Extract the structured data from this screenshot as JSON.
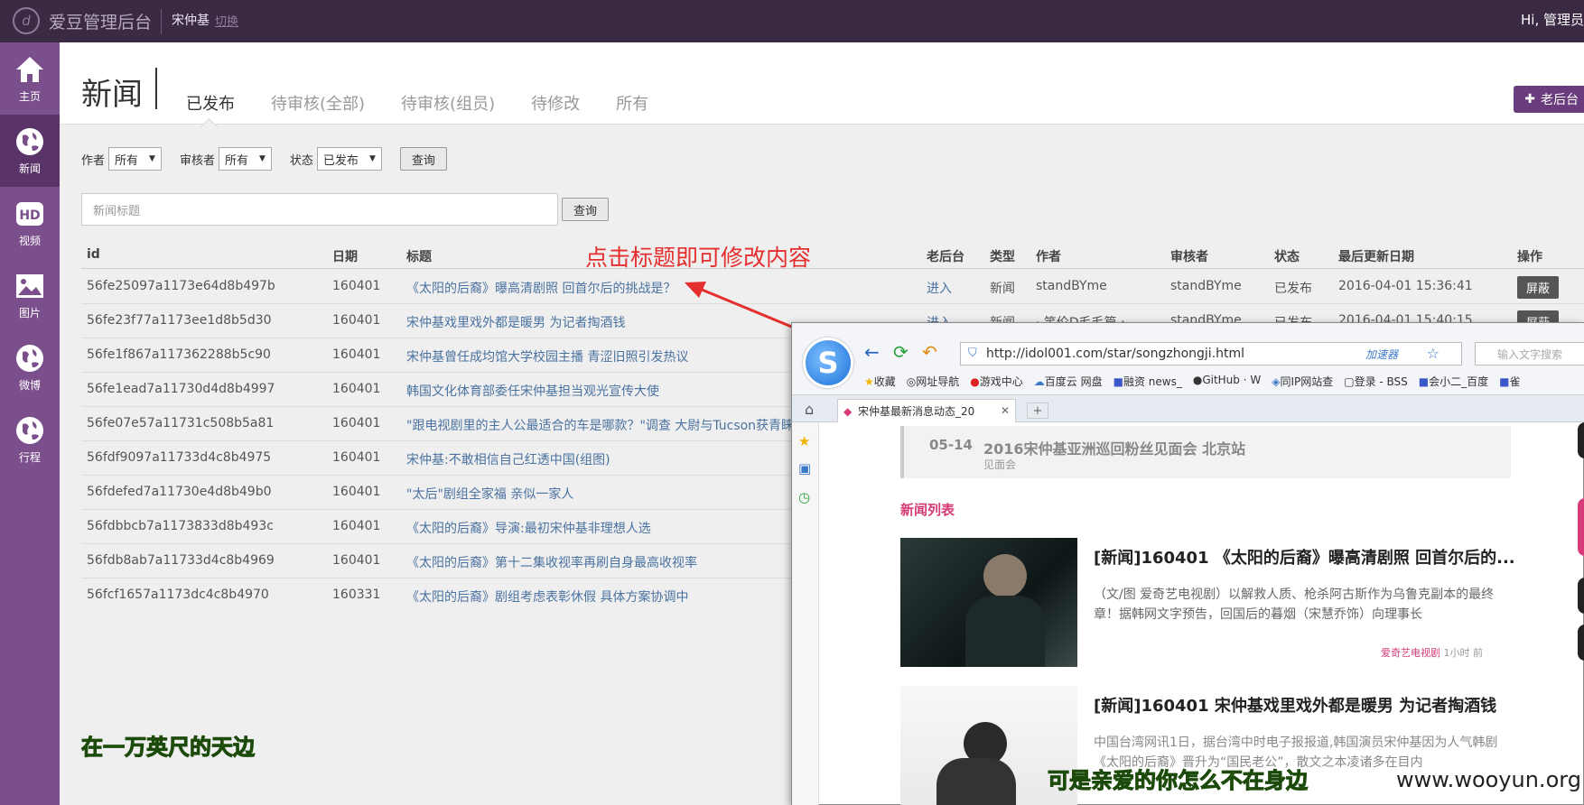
{
  "topbar": {
    "brand": "爱豆管理后台",
    "user": "宋仲基",
    "logout": "切换",
    "greeting": "Hi, 管理员"
  },
  "sidebar": {
    "items": [
      {
        "label": "主页",
        "icon": "home-icon"
      },
      {
        "label": "新闻",
        "icon": "globe-icon"
      },
      {
        "label": "视频",
        "icon": "hd-video-icon"
      },
      {
        "label": "图片",
        "icon": "image-icon"
      },
      {
        "label": "微博",
        "icon": "globe-icon"
      },
      {
        "label": "行程",
        "icon": "globe-icon"
      }
    ],
    "active": 1
  },
  "header": {
    "title": "新闻",
    "tabs": [
      "已发布",
      "待审核(全部)",
      "待审核(组员)",
      "待修改",
      "所有"
    ],
    "active_tab": 0,
    "old_admin": "老后台"
  },
  "filters": {
    "author_label": "作者",
    "author_value": "所有",
    "reviewer_label": "审核者",
    "reviewer_value": "所有",
    "status_label": "状态",
    "status_value": "已发布",
    "query": "查询"
  },
  "search": {
    "placeholder": "新闻标题",
    "button": "查询"
  },
  "table": {
    "columns": [
      "id",
      "日期",
      "标题",
      "老后台",
      "类型",
      "作者",
      "审核者",
      "状态",
      "最后更新日期",
      "操作"
    ],
    "rows": [
      {
        "id": "56fe25097a1173e64d8b497b",
        "date": "160401",
        "title": "《太阳的后裔》曝高清剧照 回首尔后的挑战是？",
        "old": "进入",
        "type": "新闻",
        "author": "standBYme",
        "reviewer": "standBYme",
        "status": "已发布",
        "updated": "2016-04-01 15:36:41",
        "op": "屏蔽"
      },
      {
        "id": "56fe23f77a1173ee1d8b5d30",
        "date": "160401",
        "title": "宋仲基戏里戏外都是暖男 为记者掏酒钱",
        "old": "进入",
        "type": "新闻",
        "author": "· 笑伦D毛毛篇 ›",
        "reviewer": "standBYme",
        "status": "已发布",
        "updated": "2016-04-01 15:40:15",
        "op": "屏蔽"
      },
      {
        "id": "56fe1f867a117362288b5c90",
        "date": "160401",
        "title": "宋仲基曾任成均馆大学校园主播 青涩旧照引发热议"
      },
      {
        "id": "56fe1ead7a11730d4d8b4997",
        "date": "160401",
        "title": "韩国文化体育部委任宋仲基担当观光宣传大使"
      },
      {
        "id": "56fe07e57a11731c508b5a81",
        "date": "160401",
        "title": "\"跟电视剧里的主人公最适合的车是哪款？\"调查 大尉与Tucson获青睐"
      },
      {
        "id": "56fdf9097a11733d4c8b4975",
        "date": "160401",
        "title": "宋仲基:不敢相信自己红透中国(组图)"
      },
      {
        "id": "56fdefed7a11730e4d8b49b0",
        "date": "160401",
        "title": "\"太后\"剧组全家福 亲似一家人"
      },
      {
        "id": "56fdbbcb7a1173833d8b493c",
        "date": "160401",
        "title": "《太阳的后裔》导演:最初宋仲基非理想人选"
      },
      {
        "id": "56fdb8ab7a11733d4c8b4969",
        "date": "160401",
        "title": "《太阳的后裔》第十二集收视率再刷自身最高收视率"
      },
      {
        "id": "56fcf1657a1173dc4c8b4970",
        "date": "160331",
        "title": "《太阳的后裔》剧组考虑表彰休假 具体方案协调中"
      }
    ]
  },
  "annotation": "点击标题即可修改内容",
  "captions": {
    "left": "在一万英尺的天边",
    "right": "可是亲爱的你怎么不在身边",
    "watermark": "www.wooyun.org"
  },
  "browser": {
    "url": "http://idol001.com/star/songzhongji.html",
    "accelerator": "加速器",
    "search_placeholder": "输入文字搜索",
    "bookmarks": [
      "收藏",
      "网址导航",
      "游戏中心",
      "百度云 网盘",
      "融资 news_",
      "GitHub · W",
      "同IP网站查",
      "登录 - BSS",
      "会小二_百度",
      "雀"
    ],
    "tab_title": "宋仲基最新消息动态_20",
    "event": {
      "date": "05-14",
      "title": "2016宋仲基亚洲巡回粉丝见面会 北京站",
      "sub": "见面会"
    },
    "news_list_label": "新闻列表",
    "news": [
      {
        "title": "[新闻]160401 《太阳的后裔》曝高清剧照 回首尔后的...",
        "desc": "（文/图 爱奇艺电视剧）以解救人质、枪杀阿古斯作为乌鲁克副本的最终章！据韩网文字预告，回国后的暮烟（宋慧乔饰）向理事长",
        "source": "爱奇艺电视剧",
        "time": "1小时 前"
      },
      {
        "title": "[新闻]160401 宋仲基戏里戏外都是暖男 为记者掏酒钱",
        "desc": "中国台湾网讯1日，据台湾中时电子报报道,韩国演员宋仲基因为人气韩剧《太阳的后裔》晋升为“国民老公”，散文之本凌诸多在目内"
      }
    ]
  },
  "colors": {
    "sidebar": "#7b4e8c",
    "topbar": "#3a2a44",
    "link": "#4a72a0",
    "annotation": "#e52e2e",
    "caption": "#66aa22"
  }
}
